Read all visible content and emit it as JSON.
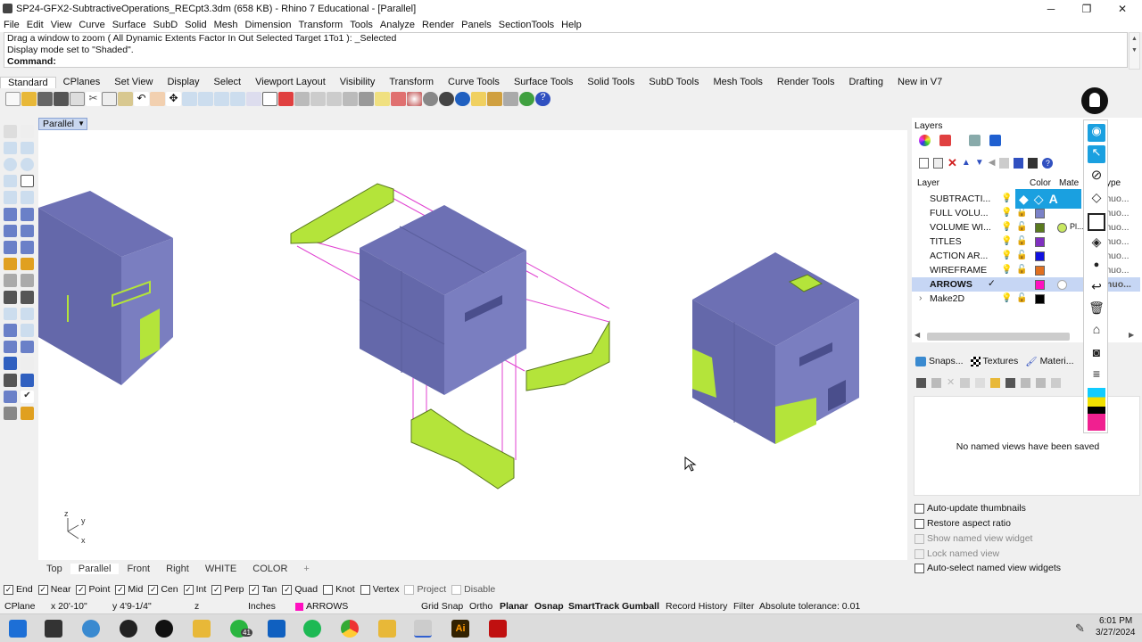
{
  "window": {
    "title": "SP24-GFX2-SubtractiveOperations_RECpt3.3dm (658 KB) - Rhino 7 Educational - [Parallel]",
    "minimize": "─",
    "maximize": "❐",
    "close": "✕"
  },
  "menu": [
    "File",
    "Edit",
    "View",
    "Curve",
    "Surface",
    "SubD",
    "Solid",
    "Mesh",
    "Dimension",
    "Transform",
    "Tools",
    "Analyze",
    "Render",
    "Panels",
    "SectionTools",
    "Help"
  ],
  "command_history": [
    "Drag a window to zoom ( All  Dynamic  Extents  Factor  In  Out  Selected  Target  1To1 ): _Selected",
    "Display mode set to \"Shaded\"."
  ],
  "command_prompt": "Command:",
  "toolbar_tabs": [
    "Standard",
    "CPlanes",
    "Set View",
    "Display",
    "Select",
    "Viewport Layout",
    "Visibility",
    "Transform",
    "Curve Tools",
    "Surface Tools",
    "Solid Tools",
    "SubD Tools",
    "Mesh Tools",
    "Render Tools",
    "Drafting",
    "New in V7"
  ],
  "viewport": {
    "label": "Parallel",
    "axes": {
      "z": "z",
      "y": "y",
      "x": "x"
    }
  },
  "viewport_tabs": [
    "Top",
    "Parallel",
    "Front",
    "Right",
    "WHITE",
    "COLOR",
    "+"
  ],
  "layers_panel": {
    "title": "Layers",
    "header": {
      "layer": "Layer",
      "color": "Color",
      "material": "Mate",
      "linetype": "ype"
    },
    "layers": [
      {
        "name": "SUBTRACTI...",
        "color": "#9ea3d6",
        "linetype": "inuo..."
      },
      {
        "name": "FULL VOLU...",
        "color": "#7b82c8",
        "linetype": "inuo..."
      },
      {
        "name": "VOLUME WI...",
        "color": "#5a7a1e",
        "material": "Pl...",
        "linetype": "inuo..."
      },
      {
        "name": "TITLES",
        "color": "#8030c0",
        "linetype": "inuo..."
      },
      {
        "name": "ACTION AR...",
        "color": "#1010e0",
        "linetype": "inuo..."
      },
      {
        "name": "WIREFRAME",
        "color": "#e07020",
        "linetype": "inuo..."
      },
      {
        "name": "ARROWS",
        "color": "#ff10c0",
        "linetype": "inuo...",
        "current": true,
        "check": "✓"
      },
      {
        "name": "Make2D",
        "color": "#000000",
        "expander": "›"
      }
    ]
  },
  "panel_tabs": [
    "Snaps...",
    "Textures",
    "Materi..."
  ],
  "named_views": {
    "empty_message": "No named views have been saved",
    "options": [
      {
        "label": "Auto-update thumbnails",
        "enabled": true
      },
      {
        "label": "Restore aspect ratio",
        "enabled": true
      },
      {
        "label": "Show named view widget",
        "enabled": false
      },
      {
        "label": "Lock named view",
        "enabled": false
      },
      {
        "label": "Auto-select named view widgets",
        "enabled": true
      }
    ]
  },
  "osnaps": [
    {
      "label": "End",
      "checked": true
    },
    {
      "label": "Near",
      "checked": true
    },
    {
      "label": "Point",
      "checked": true
    },
    {
      "label": "Mid",
      "checked": true
    },
    {
      "label": "Cen",
      "checked": true
    },
    {
      "label": "Int",
      "checked": true
    },
    {
      "label": "Perp",
      "checked": true
    },
    {
      "label": "Tan",
      "checked": true
    },
    {
      "label": "Quad",
      "checked": true
    },
    {
      "label": "Knot",
      "checked": false
    },
    {
      "label": "Vertex",
      "checked": false
    },
    {
      "label": "Project",
      "checked": false,
      "disabled": true
    },
    {
      "label": "Disable",
      "checked": false,
      "disabled": true
    }
  ],
  "statusbar": {
    "cplane": "CPlane",
    "x": "x 20'-10\"",
    "y": "y 4'9-1/4\"",
    "z": "z",
    "units": "Inches",
    "layer": "ARROWS",
    "layer_color": "#ff10c0",
    "grid_snap": "Grid Snap",
    "ortho": "Ortho",
    "planar": "Planar",
    "osnap": "Osnap",
    "smarttrack": "SmartTrack",
    "gumball": "Gumball",
    "record_history": "Record History",
    "filter": "Filter",
    "tolerance": "Absolute tolerance: 0.01"
  },
  "taskbar": {
    "time": "6:01 PM",
    "date": "3/27/2024",
    "badge": "41"
  }
}
